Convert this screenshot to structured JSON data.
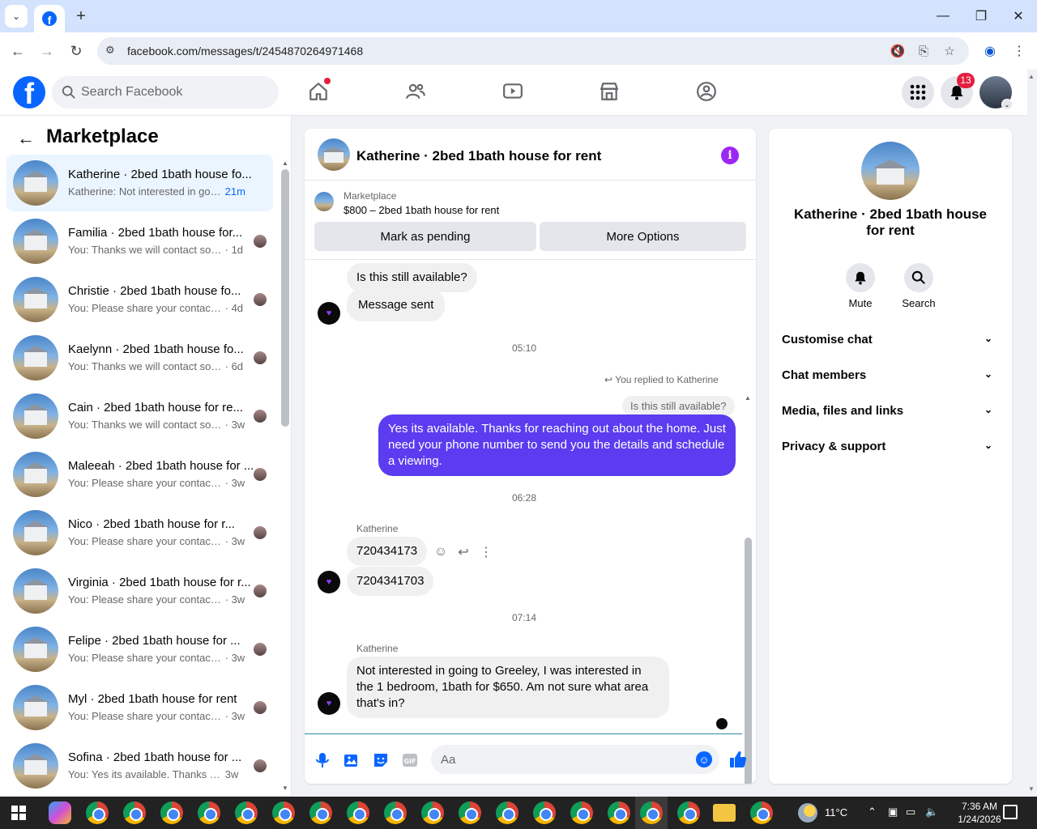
{
  "browser": {
    "url": "facebook.com/messages/t/2454870264971468"
  },
  "fb_header": {
    "search_placeholder": "Search Facebook",
    "notification_count": "13"
  },
  "sidebar": {
    "title": "Marketplace",
    "conversations": [
      {
        "name": "Katherine · 2bed 1bath house fo...",
        "preview": "Katherine: Not interested in goin...",
        "time": "21m",
        "active": true
      },
      {
        "name": "Familia · 2bed 1bath house for...",
        "preview": "You: Thanks we will contact soo...",
        "time": "· 1d"
      },
      {
        "name": "Christie · 2bed 1bath house fo...",
        "preview": "You: Please share your contact n...",
        "time": "· 4d"
      },
      {
        "name": "Kaelynn · 2bed 1bath house fo...",
        "preview": "You: Thanks we will contact soo...",
        "time": "· 6d"
      },
      {
        "name": "Cain · 2bed 1bath house for re...",
        "preview": "You: Thanks we will contact soo...",
        "time": "· 3w"
      },
      {
        "name": "Maleeah · 2bed 1bath house for ...",
        "preview": "You: Please share your contact nu...",
        "time": "· 3w"
      },
      {
        "name": "Nico · 2bed 1bath house for r...",
        "preview": "You: Please share your contact n...",
        "time": "· 3w"
      },
      {
        "name": "Virginia · 2bed 1bath house for r...",
        "preview": "You: Please share your contact nu...",
        "time": "· 3w"
      },
      {
        "name": "Felipe · 2bed 1bath house for ...",
        "preview": "You: Please share your contact n...",
        "time": "· 3w"
      },
      {
        "name": "Myl · 2bed 1bath house for rent",
        "preview": "You: Please share your contact n...",
        "time": "· 3w"
      },
      {
        "name": "Sofina · 2bed 1bath house for ...",
        "preview": "You: Yes its available. Thanks for ...",
        "time": "3w"
      }
    ]
  },
  "chat": {
    "title": "Katherine · 2bed 1bath house for rent",
    "marketplace_label": "Marketplace",
    "listing": "$800 – 2bed 1bath house for rent",
    "mark_pending": "Mark as pending",
    "more_options": "More Options",
    "messages": {
      "m1": "Is this still available?",
      "m2": "Message sent",
      "t1": "05:10",
      "reply_note": "You replied to Katherine",
      "reply_quote": "Is this still available?",
      "m3": "Yes its available. Thanks for reaching out about the home. Just need your phone number to send you the details and schedule a viewing.",
      "t2": "06:28",
      "sender1": "Katherine",
      "m4": "720434173",
      "m5": "7204341703",
      "t3": "07:14",
      "sender2": "Katherine",
      "m6": "Not interested in going to Greeley, I was interested in the 1 bedroom, 1bath for $650. Am not sure what area that's in?"
    },
    "composer_placeholder": "Aa"
  },
  "info_panel": {
    "name": "Katherine · 2bed 1bath house for rent",
    "mute_label": "Mute",
    "search_label": "Search",
    "sections": [
      "Customise chat",
      "Chat members",
      "Media, files and links",
      "Privacy & support"
    ]
  },
  "taskbar": {
    "temperature": "11°C",
    "time": "7:36 AM",
    "date": "1/24/2026"
  },
  "colors": {
    "fb_blue": "#0866ff",
    "outgoing_bubble": "#5b3cf0",
    "active_conv_bg": "#ebf5ff",
    "badge_red": "#e41e3f"
  }
}
